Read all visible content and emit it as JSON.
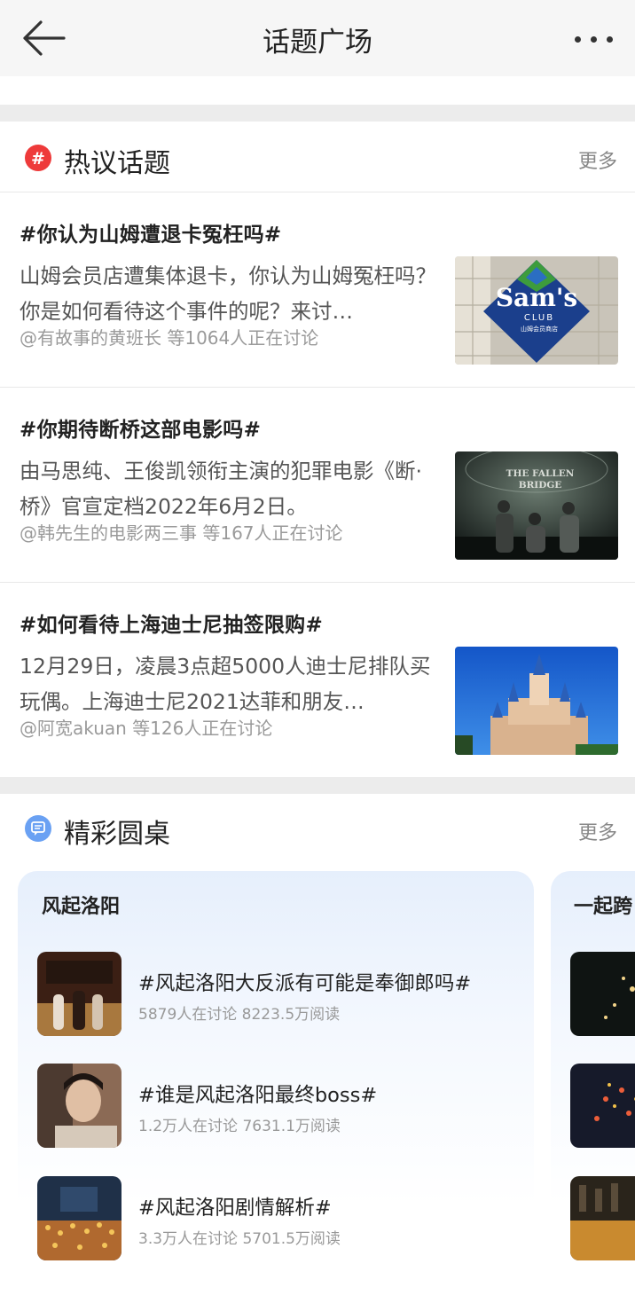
{
  "header": {
    "title": "话题广场"
  },
  "hot": {
    "heading": "热议话题",
    "more": "更多",
    "topics": [
      {
        "title": "#你认为山姆遭退卡冤枉吗#",
        "desc": "山姆会员店遭集体退卡，你认为山姆冤枉吗？你是如何看待这个事件的呢？来讨…",
        "meta": "@有故事的黄班长 等1064人正在讨论"
      },
      {
        "title": "#你期待断桥这部电影吗#",
        "desc": "由马思纯、王俊凯领衔主演的犯罪电影《断·桥》官宣定档2022年6月2日。",
        "meta": "@韩先生的电影两三事 等167人正在讨论"
      },
      {
        "title": "#如何看待上海迪士尼抽签限购#",
        "desc": "12月29日，凌晨3点超5000人迪士尼排队买玩偶。上海迪士尼2021达菲和朋友…",
        "meta": "@阿宽akuan 等126人正在讨论"
      }
    ],
    "thumb_text": {
      "sams_logo": "Sam's",
      "sams_club": "CLUB",
      "sams_sub": "山姆会员商店",
      "bridge_line1": "THE FALLEN",
      "bridge_line2": "BRIDGE"
    }
  },
  "roundtable": {
    "heading": "精彩圆桌",
    "more": "更多",
    "cards": [
      {
        "title": "风起洛阳",
        "items": [
          {
            "name": "#风起洛阳大反派有可能是奉御郎吗#",
            "stats": "5879人在讨论 8223.5万阅读"
          },
          {
            "name": "#谁是风起洛阳最终boss#",
            "stats": "1.2万人在讨论 7631.1万阅读"
          },
          {
            "name": "#风起洛阳剧情解析#",
            "stats": "3.3万人在讨论 5701.5万阅读"
          }
        ]
      },
      {
        "title": "一起跨"
      }
    ]
  },
  "colors": {
    "hot_icon": "#ee3a3a",
    "round_icon": "#6aa1f3",
    "divider": "#ececec"
  }
}
